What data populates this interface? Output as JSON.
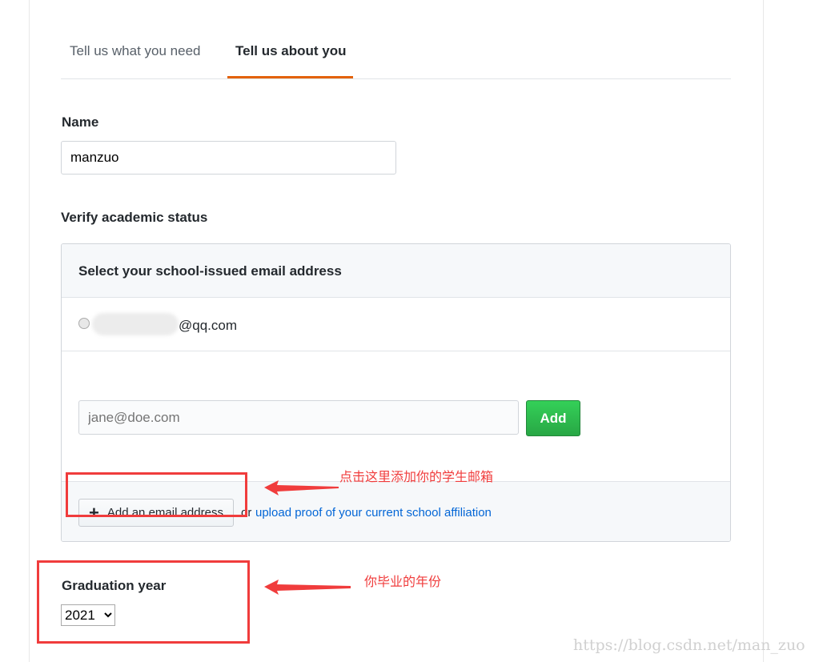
{
  "tabs": [
    {
      "label": "Tell us what you need",
      "active": false
    },
    {
      "label": "Tell us about you",
      "active": true
    }
  ],
  "accent": "#e36209",
  "name": {
    "label": "Name",
    "value": "manzuo"
  },
  "verify": {
    "label": "Verify academic status",
    "box_title": "Select your school-issued email address",
    "existing_email_suffix": "@qq.com",
    "new_email_placeholder": "jane@doe.com",
    "add_label": "Add",
    "add_email_label": "Add an email address",
    "or_text": "or",
    "upload_link": "upload proof of your current school affiliation"
  },
  "graduation": {
    "label": "Graduation year",
    "selected": "2021"
  },
  "annotations": {
    "email_note": "点击这里添加你的学生邮箱",
    "year_note": "你毕业的年份"
  },
  "watermark": "https://blog.csdn.net/man_zuo"
}
